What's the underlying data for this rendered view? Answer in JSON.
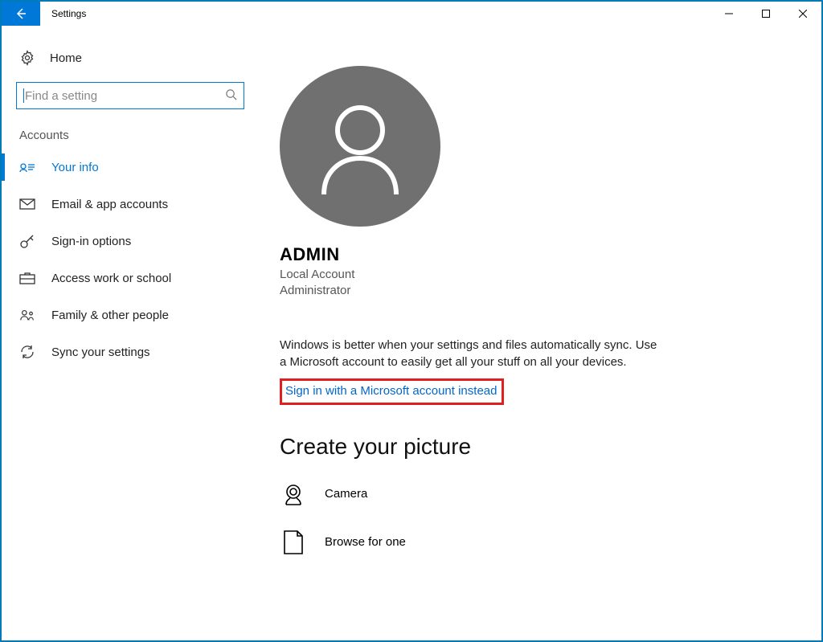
{
  "window": {
    "title": "Settings"
  },
  "sidebar": {
    "home": "Home",
    "search_placeholder": "Find a setting",
    "section": "Accounts",
    "items": [
      {
        "label": "Your info"
      },
      {
        "label": "Email & app accounts"
      },
      {
        "label": "Sign-in options"
      },
      {
        "label": "Access work or school"
      },
      {
        "label": "Family & other people"
      },
      {
        "label": "Sync your settings"
      }
    ]
  },
  "main": {
    "username": "ADMIN",
    "account_type": "Local Account",
    "role": "Administrator",
    "description": "Windows is better when your settings and files automatically sync. Use a Microsoft account to easily get all your stuff on all your devices.",
    "signin_link": "Sign in with a Microsoft account instead",
    "create_picture_heading": "Create your picture",
    "camera_label": "Camera",
    "browse_label": "Browse for one"
  }
}
